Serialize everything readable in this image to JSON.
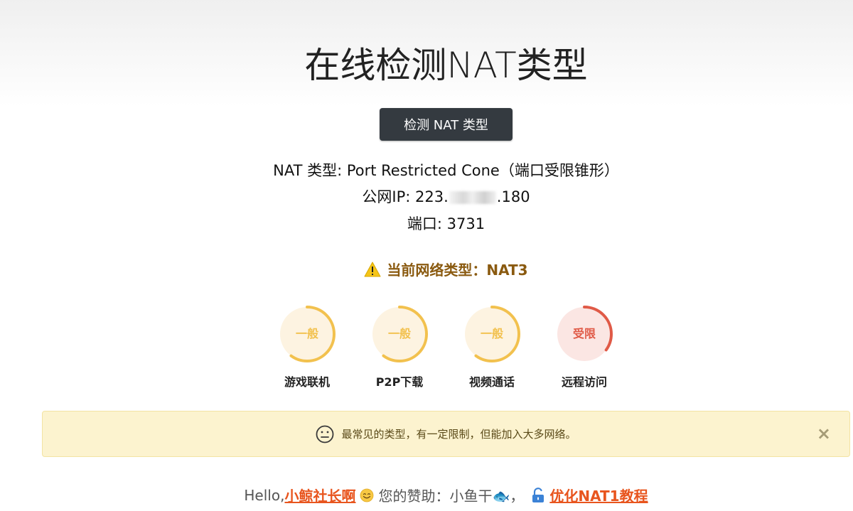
{
  "page": {
    "title": "在线检测NAT类型"
  },
  "detect_button": {
    "label": "检测 NAT 类型"
  },
  "result": {
    "nat_type_line": "NAT 类型: Port Restricted Cone（端口受限锥形）",
    "ip_prefix": "公网IP: 223.",
    "ip_suffix": ".180",
    "port_line": "端口: 3731"
  },
  "nat_level": {
    "text": "当前网络类型：NAT3",
    "icon": "warning-icon",
    "color": "#8a5a10"
  },
  "gauges": [
    {
      "status": "一般",
      "label": "游戏联机",
      "level": 0.6,
      "color": "#f2c14e",
      "bg": "#fdf3e1"
    },
    {
      "status": "一般",
      "label": "P2P下载",
      "level": 0.6,
      "color": "#f2c14e",
      "bg": "#fdf3e1"
    },
    {
      "status": "一般",
      "label": "视频通话",
      "level": 0.6,
      "color": "#f2c14e",
      "bg": "#fdf3e1"
    },
    {
      "status": "受限",
      "label": "远程访问",
      "level": 0.35,
      "color": "#e05a47",
      "bg": "#fbe6e3"
    }
  ],
  "alert": {
    "text": "最常见的类型，有一定限制，但能加入大多网络。",
    "icon": "neutral-face-icon",
    "close": "×"
  },
  "footer": {
    "hello": "Hello, ",
    "name": "小鲸社长啊",
    "sponsor": "您的赞助：小鱼干🐟，",
    "tutorial": "优化NAT1教程"
  }
}
